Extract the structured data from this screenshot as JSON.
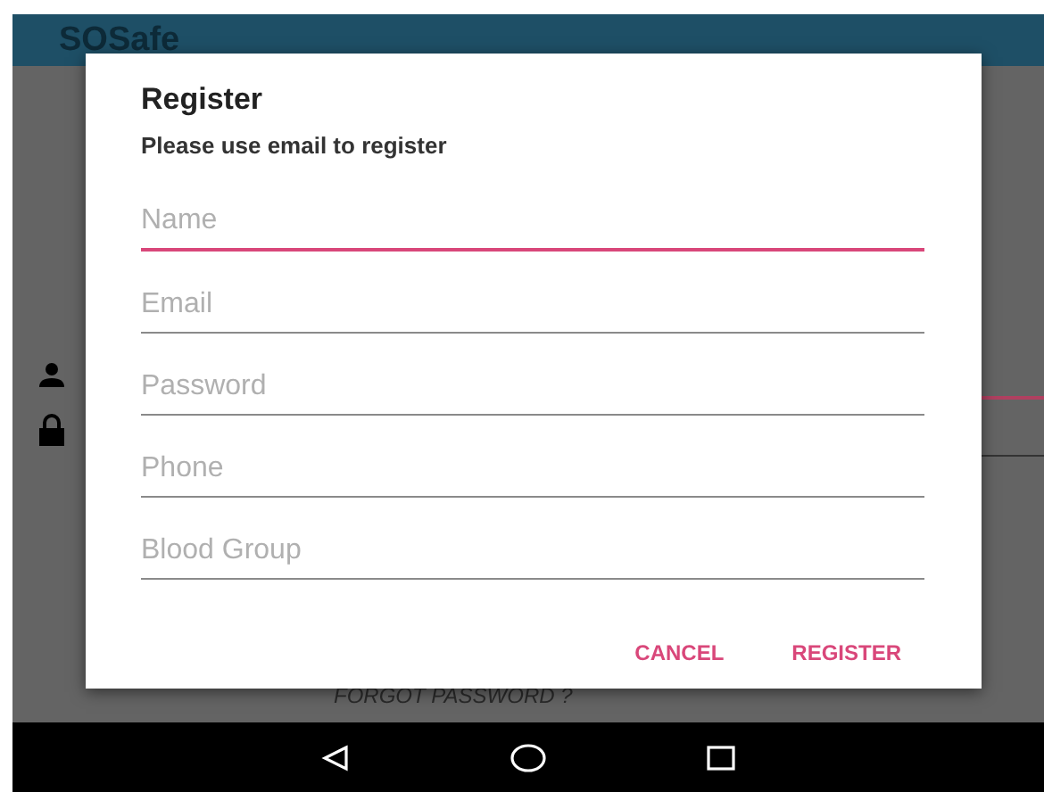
{
  "app_bar": {
    "title": "SOSafe"
  },
  "dialog": {
    "title": "Register",
    "subtitle": "Please use email to register",
    "fields": [
      {
        "placeholder": "Name",
        "focused": true
      },
      {
        "placeholder": "Email",
        "focused": false
      },
      {
        "placeholder": "Password",
        "focused": false
      },
      {
        "placeholder": "Phone",
        "focused": false
      },
      {
        "placeholder": "Blood Group",
        "focused": false
      }
    ],
    "buttons": [
      "CANCEL",
      "REGISTER"
    ]
  },
  "background": {
    "forgot_link": "FORGOT PASSWORD ?"
  }
}
